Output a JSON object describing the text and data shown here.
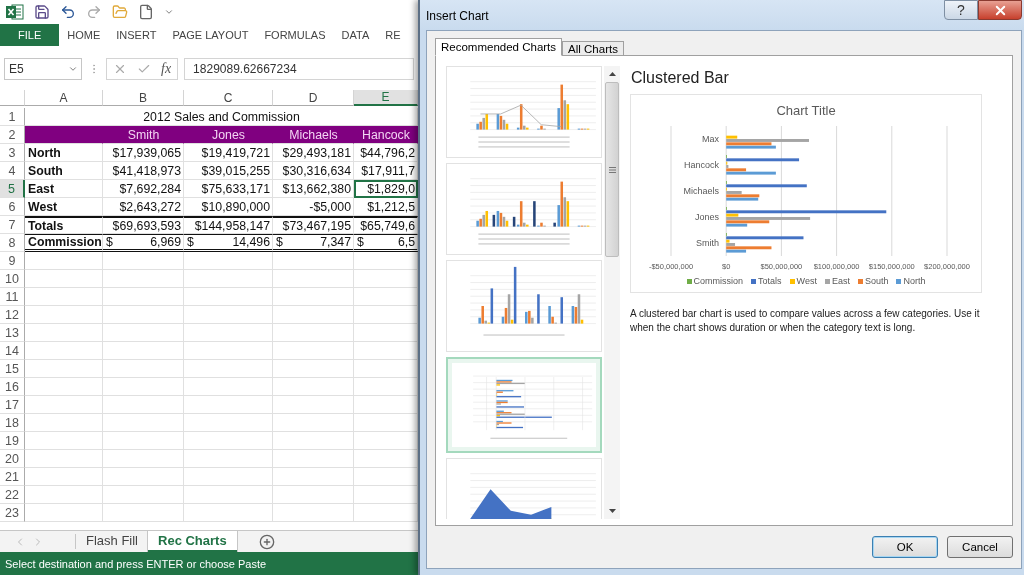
{
  "ribbon": {
    "tabs": [
      {
        "label": "FILE",
        "kind": "file"
      },
      {
        "label": "HOME",
        "kind": "tab"
      },
      {
        "label": "INSERT",
        "kind": "tab"
      },
      {
        "label": "PAGE LAYOUT",
        "kind": "tab"
      },
      {
        "label": "FORMULAS",
        "kind": "tab"
      },
      {
        "label": "DATA",
        "kind": "tab"
      },
      {
        "label": "RE",
        "kind": "tab"
      }
    ]
  },
  "formula_bar": {
    "name_box": "E5",
    "fx": "fx",
    "value": "1829089.62667234"
  },
  "sheet": {
    "columns": [
      {
        "label": "A",
        "selected": false
      },
      {
        "label": "B",
        "selected": false
      },
      {
        "label": "C",
        "selected": false
      },
      {
        "label": "D",
        "selected": false
      },
      {
        "label": "E",
        "selected": true
      }
    ],
    "rows": [
      {
        "number": "1",
        "selected": false,
        "kind": "title",
        "cells": [
          "2012 Sales and Commission"
        ]
      },
      {
        "number": "2",
        "selected": false,
        "kind": "header",
        "cells": [
          "",
          "Smith",
          "Jones",
          "Michaels",
          "Hancock"
        ]
      },
      {
        "number": "3",
        "selected": false,
        "kind": "data",
        "cells": [
          "North",
          "$17,939,065",
          "$19,419,721",
          "$29,493,181",
          "$44,796,2"
        ]
      },
      {
        "number": "4",
        "selected": false,
        "kind": "data",
        "cells": [
          "South",
          "$41,418,973",
          "$39,015,255",
          "$30,316,634",
          "$17,911,7"
        ]
      },
      {
        "number": "5",
        "selected": true,
        "kind": "data",
        "cells": [
          "East",
          "$7,692,284",
          "$75,633,171",
          "$13,662,380",
          "$1,829,0"
        ]
      },
      {
        "number": "6",
        "selected": false,
        "kind": "data",
        "cells": [
          "West",
          "$2,643,272",
          "$10,890,000",
          "-$5,000",
          "$1,212,5"
        ]
      },
      {
        "number": "7",
        "selected": false,
        "kind": "total",
        "cells": [
          "Totals",
          "$69,693,593",
          "$144,958,147",
          "$73,467,195",
          "$65,749,6"
        ]
      },
      {
        "number": "8",
        "selected": false,
        "kind": "commission",
        "cells": [
          "Commission",
          {
            "symbol": "$",
            "amount": "6,969"
          },
          {
            "symbol": "$",
            "amount": "14,496"
          },
          {
            "symbol": "$",
            "amount": "7,347"
          },
          {
            "symbol": "$",
            "amount": "6,5"
          }
        ]
      },
      {
        "number": "9",
        "selected": false,
        "kind": "empty"
      },
      {
        "number": "10",
        "selected": false,
        "kind": "empty"
      },
      {
        "number": "11",
        "selected": false,
        "kind": "empty"
      },
      {
        "number": "12",
        "selected": false,
        "kind": "empty"
      },
      {
        "number": "13",
        "selected": false,
        "kind": "empty"
      },
      {
        "number": "14",
        "selected": false,
        "kind": "empty"
      },
      {
        "number": "15",
        "selected": false,
        "kind": "empty"
      },
      {
        "number": "16",
        "selected": false,
        "kind": "empty"
      },
      {
        "number": "17",
        "selected": false,
        "kind": "empty"
      },
      {
        "number": "18",
        "selected": false,
        "kind": "empty"
      },
      {
        "number": "19",
        "selected": false,
        "kind": "empty"
      },
      {
        "number": "20",
        "selected": false,
        "kind": "empty"
      },
      {
        "number": "21",
        "selected": false,
        "kind": "empty"
      },
      {
        "number": "22",
        "selected": false,
        "kind": "empty"
      },
      {
        "number": "23",
        "selected": false,
        "kind": "empty"
      }
    ]
  },
  "sheet_tabs": [
    {
      "label": "Flash Fill",
      "selected": false
    },
    {
      "label": "Rec Charts",
      "selected": true
    }
  ],
  "status_bar": "Select destination and press ENTER or choose Paste",
  "dialog": {
    "title": "Insert Chart",
    "help": "?",
    "tabs": [
      {
        "label": "Recommended Charts",
        "selected": true
      },
      {
        "label": "All Charts",
        "selected": false
      }
    ],
    "thumbnails": [
      {
        "kind": "combo",
        "selected": false
      },
      {
        "kind": "column",
        "selected": false
      },
      {
        "kind": "column-by-name",
        "selected": false
      },
      {
        "kind": "bar",
        "selected": true
      },
      {
        "kind": "area",
        "selected": false
      }
    ],
    "preview": {
      "heading": "Clustered Bar",
      "chart_data": {
        "type": "bar",
        "orientation": "horizontal",
        "title": "Chart Title",
        "categories": [
          "Max",
          "Hancock",
          "Michaels",
          "Jones",
          "Smith"
        ],
        "series": [
          {
            "name": "North",
            "color": "#5b9bd5",
            "values": [
              45000000,
              45000000,
              29000000,
              19000000,
              18000000
            ]
          },
          {
            "name": "South",
            "color": "#ed7d31",
            "values": [
              41000000,
              18000000,
              30000000,
              39000000,
              41000000
            ]
          },
          {
            "name": "East",
            "color": "#a5a5a5",
            "values": [
              75000000,
              2000000,
              14000000,
              76000000,
              8000000
            ]
          },
          {
            "name": "West",
            "color": "#ffc000",
            "values": [
              10000000,
              1000000,
              0,
              11000000,
              3000000
            ]
          },
          {
            "name": "Totals",
            "color": "#4472c4",
            "values": [
              null,
              66000000,
              73000000,
              145000000,
              70000000
            ]
          },
          {
            "name": "Commission",
            "color": "#70ad47",
            "values": [
              null,
              0,
              0,
              0,
              0
            ]
          }
        ],
        "grid": true,
        "legend": true,
        "xlim": [
          -50000000,
          200000000
        ],
        "xticks": [
          {
            "value": -50000000,
            "label": "-$50,000,000"
          },
          {
            "value": 0,
            "label": "$0"
          },
          {
            "value": 50000000,
            "label": "$50,000,000"
          },
          {
            "value": 100000000,
            "label": "$100,000,000"
          },
          {
            "value": 150000000,
            "label": "$150,000,000"
          },
          {
            "value": 200000000,
            "label": "$200,000,000"
          }
        ]
      },
      "description": "A clustered bar chart is used to compare values across a few categories. Use it when the chart shows duration or when the category text is long."
    },
    "buttons": [
      {
        "label": "OK",
        "kind": "default"
      },
      {
        "label": "Cancel",
        "kind": "normal"
      }
    ]
  }
}
